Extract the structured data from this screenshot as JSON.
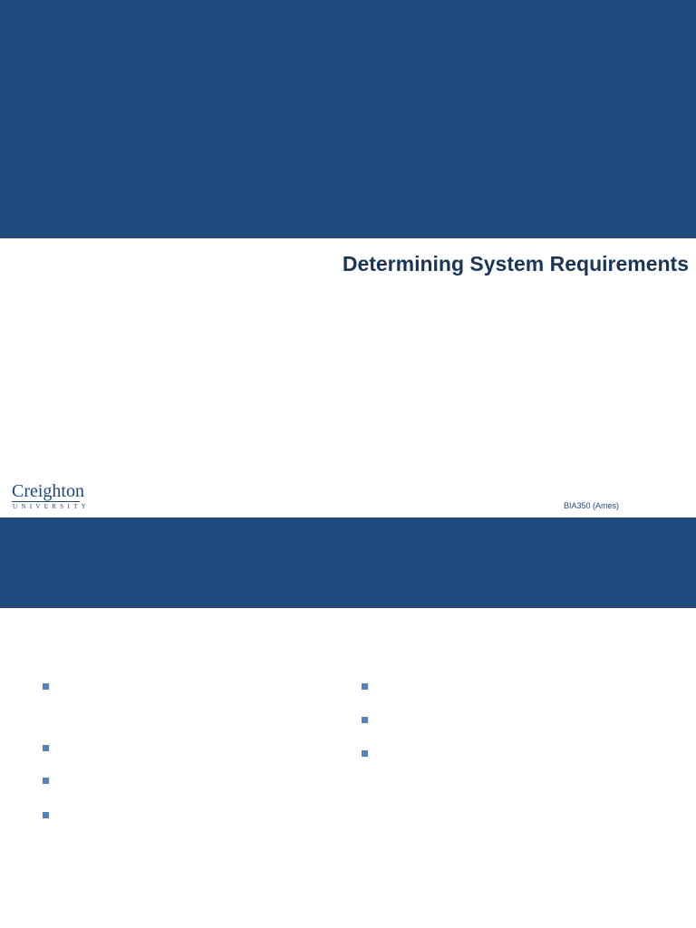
{
  "colors": {
    "header_band": "#1f497d",
    "title_text": "#1b3556",
    "bullet": "#4f81bd",
    "background": "#ffffff"
  },
  "slide1": {
    "title": "Determining System Requirements",
    "logo": {
      "word": "Creighton",
      "sub": "UNIVERSITY"
    },
    "course_label": "BIA350 (Ames)"
  },
  "slide2": {
    "left_bullets": [
      "",
      "",
      "",
      ""
    ],
    "right_bullets": [
      "",
      "",
      ""
    ]
  }
}
